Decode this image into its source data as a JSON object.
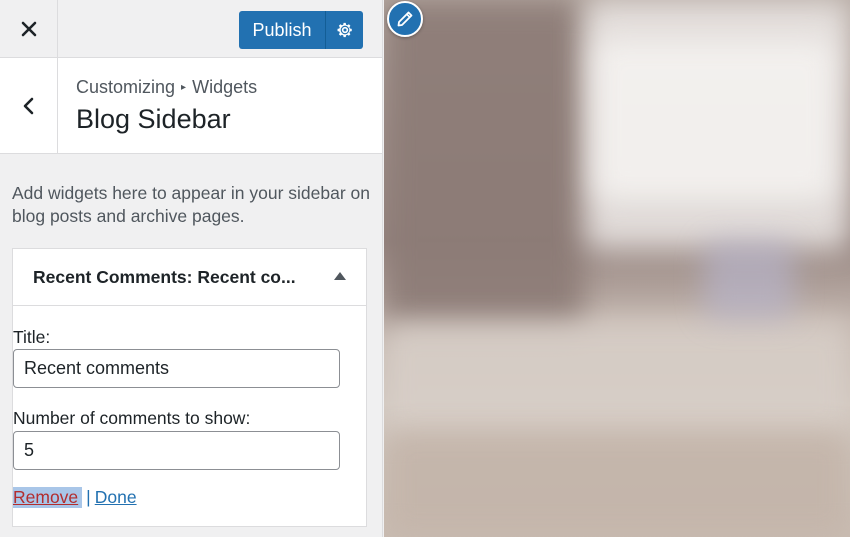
{
  "header": {
    "close_icon": "close-icon",
    "publish_label": "Publish",
    "settings_icon": "gear-icon"
  },
  "section": {
    "back_icon": "chevron-left-icon",
    "breadcrumb_parent": "Customizing",
    "breadcrumb_separator": "▸",
    "breadcrumb_current": "Widgets",
    "title": "Blog Sidebar"
  },
  "description": "Add widgets here to appear in your sidebar on blog posts and archive pages.",
  "widget": {
    "title_prefix": "Recent Comments:",
    "title_value": "Recent co...",
    "toggle_icon": "arrow-up-icon",
    "fields": {
      "title_label": "Title:",
      "title_value": "Recent comments",
      "count_label": "Number of comments to show:",
      "count_value": "5"
    },
    "actions": {
      "remove_label": "Remove",
      "divider": "|",
      "done_label": "Done"
    }
  },
  "preview": {
    "edit_icon": "pencil-icon"
  },
  "colors": {
    "accent": "#2271b1",
    "remove": "#b32d2e",
    "panel_bg": "#f0f0f1"
  }
}
